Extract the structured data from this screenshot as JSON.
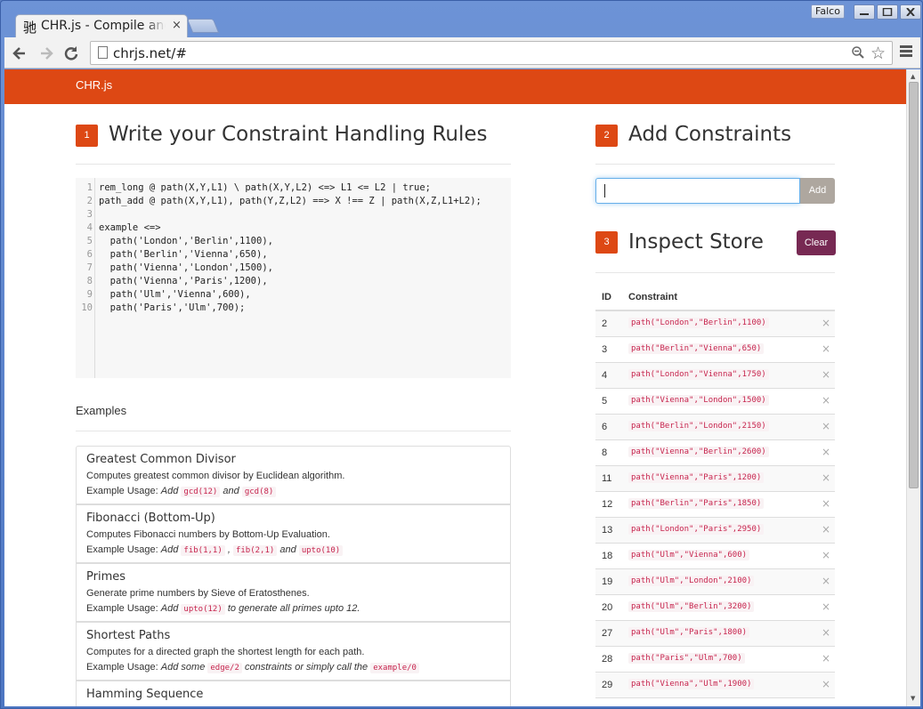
{
  "browser": {
    "user_badge": "Falco",
    "tab_title": "CHR.js - Compile and Run",
    "tab_favicon": "驰",
    "tab_close": "×",
    "url": "chrjs.net/#"
  },
  "navbar": {
    "brand": "CHR.js"
  },
  "editor_section": {
    "step": "1",
    "title": "Write your Constraint Handling Rules",
    "lines": [
      "rem_long @ path(X,Y,L1) \\ path(X,Y,L2) <=> L1 <= L2 | true;",
      "path_add @ path(X,Y,L1), path(Y,Z,L2) ==> X !== Z | path(X,Z,L1+L2);",
      "",
      "example <=>",
      "  path('London','Berlin',1100),",
      "  path('Berlin','Vienna',650),",
      "  path('Vienna','London',1500),",
      "  path('Vienna','Paris',1200),",
      "  path('Ulm','Vienna',600),",
      "  path('Paris','Ulm',700);"
    ]
  },
  "examples": {
    "title": "Examples",
    "items": [
      {
        "title": "Greatest Common Divisor",
        "desc": "Computes greatest common divisor by Euclidean algorithm.",
        "usage_label": "Example Usage:",
        "usage_parts": [
          "Add",
          "gcd(12)",
          "and",
          "gcd(8)"
        ]
      },
      {
        "title": "Fibonacci (Bottom-Up)",
        "desc": "Computes Fibonacci numbers by Bottom-Up Evaluation.",
        "usage_label": "Example Usage:",
        "usage_parts": [
          "Add",
          "fib(1,1)",
          ",",
          "fib(2,1)",
          "and",
          "upto(10)"
        ]
      },
      {
        "title": "Primes",
        "desc": "Generate prime numbers by Sieve of Eratosthenes.",
        "usage_label": "Example Usage:",
        "usage_parts": [
          "Add",
          "upto(12)",
          "to generate all primes upto 12."
        ]
      },
      {
        "title": "Shortest Paths",
        "desc": "Computes for a directed graph the shortest length for each path.",
        "usage_label": "Example Usage:",
        "usage_parts": [
          "Add some",
          "edge/2",
          "constraints or simply call the",
          "example/0"
        ]
      },
      {
        "title": "Hamming Sequence",
        "desc": "",
        "usage_label": "",
        "usage_parts": []
      }
    ]
  },
  "constraints_section": {
    "step": "2",
    "title": "Add Constraints",
    "input_value": "",
    "add_label": "Add"
  },
  "store_section": {
    "step": "3",
    "title": "Inspect Store",
    "clear_label": "Clear",
    "columns": [
      "ID",
      "Constraint"
    ],
    "rows": [
      {
        "id": "2",
        "constraint": "path(\"London\",\"Berlin\",1100)"
      },
      {
        "id": "3",
        "constraint": "path(\"Berlin\",\"Vienna\",650)"
      },
      {
        "id": "4",
        "constraint": "path(\"London\",\"Vienna\",1750)"
      },
      {
        "id": "5",
        "constraint": "path(\"Vienna\",\"London\",1500)"
      },
      {
        "id": "6",
        "constraint": "path(\"Berlin\",\"London\",2150)"
      },
      {
        "id": "8",
        "constraint": "path(\"Vienna\",\"Berlin\",2600)"
      },
      {
        "id": "11",
        "constraint": "path(\"Vienna\",\"Paris\",1200)"
      },
      {
        "id": "12",
        "constraint": "path(\"Berlin\",\"Paris\",1850)"
      },
      {
        "id": "13",
        "constraint": "path(\"London\",\"Paris\",2950)"
      },
      {
        "id": "18",
        "constraint": "path(\"Ulm\",\"Vienna\",600)"
      },
      {
        "id": "19",
        "constraint": "path(\"Ulm\",\"London\",2100)"
      },
      {
        "id": "20",
        "constraint": "path(\"Ulm\",\"Berlin\",3200)"
      },
      {
        "id": "27",
        "constraint": "path(\"Ulm\",\"Paris\",1800)"
      },
      {
        "id": "28",
        "constraint": "path(\"Paris\",\"Ulm\",700)"
      },
      {
        "id": "29",
        "constraint": "path(\"Vienna\",\"Ulm\",1900)"
      }
    ],
    "delete_glyph": "×"
  },
  "colors": {
    "brand": "#dd4814",
    "clear": "#772953",
    "add": "#aea79f"
  }
}
